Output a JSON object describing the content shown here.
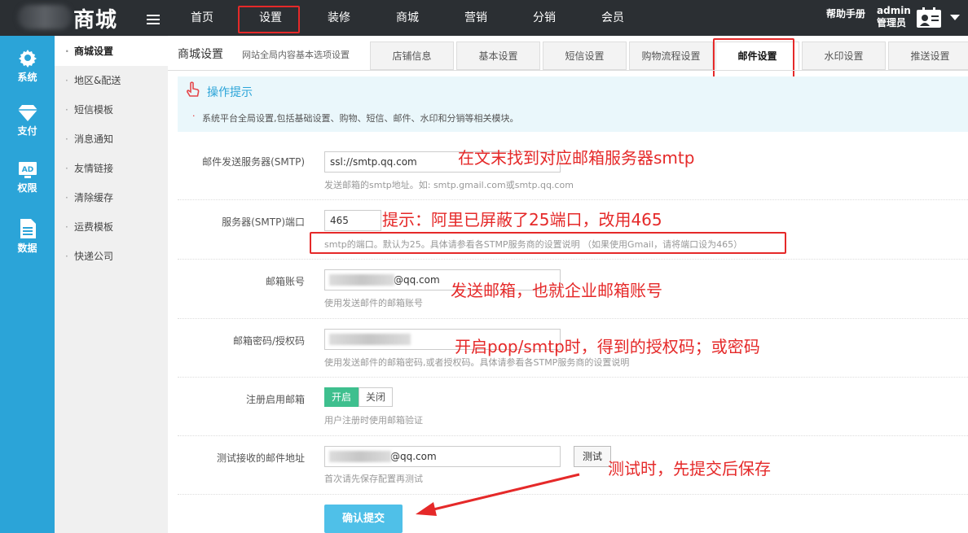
{
  "header": {
    "logo_text": "商城",
    "nav": [
      "首页",
      "设置",
      "装修",
      "商城",
      "营销",
      "分销",
      "会员"
    ],
    "active_nav_index": 1,
    "help": "帮助手册",
    "user_name": "admin",
    "user_role": "管理员"
  },
  "icon_sidebar": [
    {
      "label": "系统",
      "icon": "gear-icon"
    },
    {
      "label": "支付",
      "icon": "diamond-icon"
    },
    {
      "label": "权限",
      "icon": "ad-icon"
    },
    {
      "label": "数据",
      "icon": "document-icon"
    }
  ],
  "sub_sidebar": [
    "商城设置",
    "地区&配送",
    "短信模板",
    "消息通知",
    "友情链接",
    "清除缓存",
    "运费模板",
    "快递公司"
  ],
  "page": {
    "title": "商城设置",
    "subtitle": "网站全局内容基本选项设置",
    "tabs": [
      "店铺信息",
      "基本设置",
      "短信设置",
      "购物流程设置",
      "邮件设置",
      "水印设置",
      "推送设置"
    ],
    "active_tab_index": 4
  },
  "tips": {
    "title": "操作提示",
    "text": "系统平台全局设置,包括基础设置、购物、短信、邮件、水印和分销等相关模块。"
  },
  "form": {
    "smtp_label": "邮件发送服务器(SMTP)",
    "smtp_value": "ssl://smtp.qq.com",
    "smtp_hint": "发送邮箱的smtp地址。如: smtp.gmail.com或smtp.qq.com",
    "port_label": "服务器(SMTP)端口",
    "port_value": "465",
    "port_hint": "smtp的端口。默认为25。具体请参看各STMP服务商的设置说明 （如果使用Gmail，请将端口设为465）",
    "account_label": "邮箱账号",
    "account_value": "@qq.com",
    "account_hint": "使用发送邮件的邮箱账号",
    "password_label": "邮箱密码/授权码",
    "password_hint": "使用发送邮件的邮箱密码,或者授权码。具体请参看各STMP服务商的设置说明",
    "register_label": "注册启用邮箱",
    "toggle_on": "开启",
    "toggle_off": "关闭",
    "register_hint": "用户注册时使用邮箱验证",
    "test_label": "测试接收的邮件地址",
    "test_value": "@qq.com",
    "test_button": "测试",
    "test_hint": "首次请先保存配置再测试",
    "submit": "确认提交"
  },
  "annotations": {
    "smtp_note": "在文末找到对应邮箱服务器smtp",
    "port_note": "提示：阿里已屏蔽了25端口，改用465",
    "account_note": "发送邮箱，也就企业邮箱账号",
    "password_note": "开启pop/smtp时，得到的授权码；或密码",
    "test_note": "测试时，先提交后保存"
  },
  "colors": {
    "topbar": "#2b2f33",
    "sidebar": "#2ba4d8",
    "accent_red": "#e52929",
    "toggle_on": "#3ebf8e",
    "submit": "#4fc0e8"
  }
}
